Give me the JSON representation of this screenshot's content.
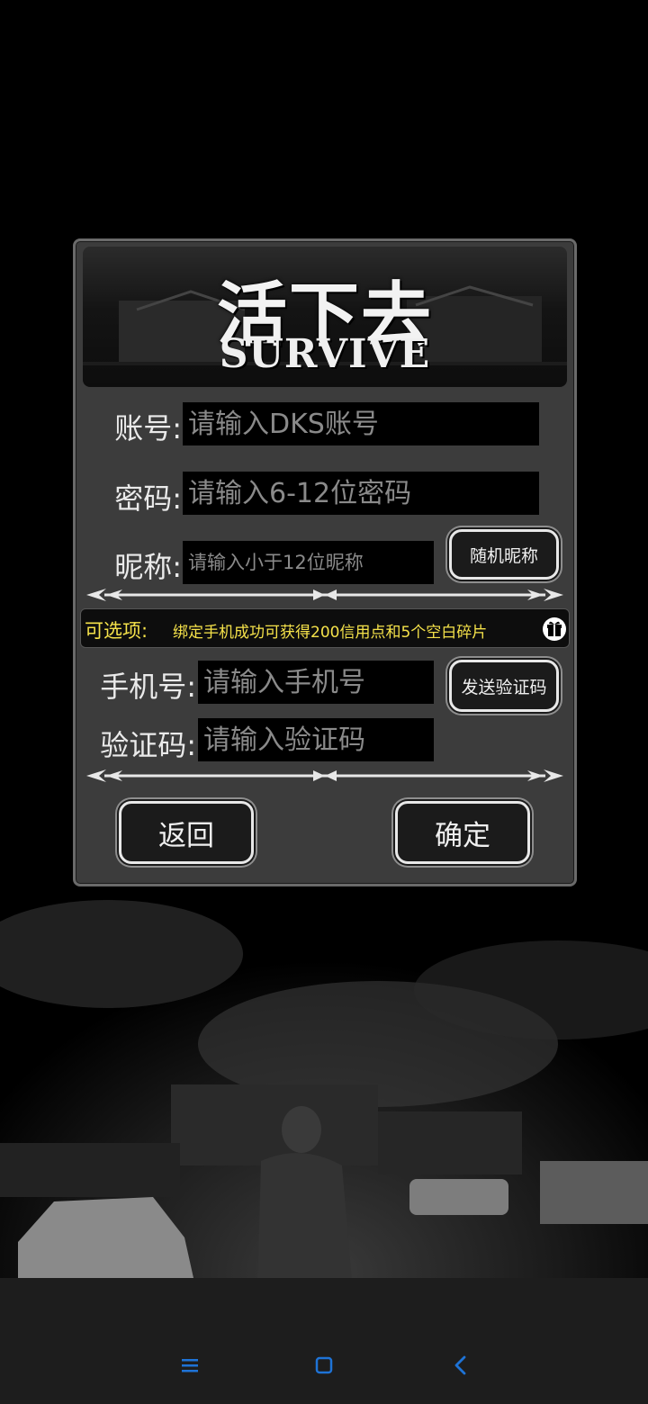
{
  "app": {
    "logo_cn": "活下去",
    "logo_en": "SURVIVE"
  },
  "form": {
    "account": {
      "label": "账号:",
      "placeholder": "请输入DKS账号"
    },
    "password": {
      "label": "密码:",
      "placeholder": "请输入6-12位密码"
    },
    "nickname": {
      "label": "昵称:",
      "placeholder": "请输入小于12位昵称"
    },
    "random_nickname_button": "随机昵称",
    "optional": {
      "label": "可选项:",
      "text": "绑定手机成功可获得200信用点和5个空白碎片"
    },
    "phone": {
      "label": "手机号:",
      "placeholder": "请输入手机号"
    },
    "send_code_button": "发送验证码",
    "code": {
      "label": "验证码:",
      "placeholder": "请输入验证码"
    },
    "back_button": "返回",
    "confirm_button": "确定"
  },
  "icons": {
    "gift": "gift-icon",
    "nav_menu": "menu-icon",
    "nav_home": "home-square-icon",
    "nav_back": "back-chevron-icon"
  },
  "colors": {
    "accent_yellow": "#f5e24a",
    "nav_blue": "#1e73d6"
  }
}
